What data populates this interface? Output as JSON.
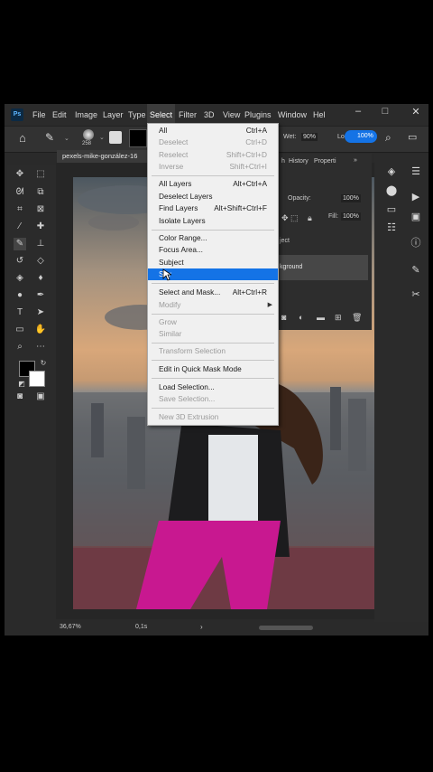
{
  "menubar": {
    "items": [
      "File",
      "Edit",
      "Image",
      "Layer",
      "Type",
      "Select",
      "Filter",
      "3D",
      "View",
      "Plugins",
      "Window",
      "Help"
    ],
    "help_visible": "Hel"
  },
  "window_controls": {
    "minimize": "–",
    "maximize": "□",
    "close": "✕"
  },
  "options_bar": {
    "brush_size": "258",
    "wet_label": "Wet:",
    "wet_value": "90%",
    "load_label": "Lo",
    "flow_value": "100%"
  },
  "document_tab": "pexels-mike-gonzález-16",
  "panels": {
    "tabs": [
      "h",
      "History",
      "Properti"
    ],
    "opacity_label": "Opacity:",
    "opacity_value": "100%",
    "fill_label": "Fill:",
    "fill_value": "100%",
    "subject_text": "ject",
    "layer_name": "kground"
  },
  "status": {
    "zoom": "36,67%",
    "time": "0,1s"
  },
  "select_menu": {
    "items": [
      {
        "label": "All",
        "shortcut": "Ctrl+A",
        "disabled": false
      },
      {
        "label": "Deselect",
        "shortcut": "Ctrl+D",
        "disabled": true
      },
      {
        "label": "Reselect",
        "shortcut": "Shift+Ctrl+D",
        "disabled": true
      },
      {
        "label": "Inverse",
        "shortcut": "Shift+Ctrl+I",
        "disabled": true
      },
      {
        "label": "All Layers",
        "shortcut": "Alt+Ctrl+A",
        "disabled": false
      },
      {
        "label": "Deselect Layers",
        "shortcut": "",
        "disabled": false
      },
      {
        "label": "Find Layers",
        "shortcut": "Alt+Shift+Ctrl+F",
        "disabled": false
      },
      {
        "label": "Isolate Layers",
        "shortcut": "",
        "disabled": false
      },
      {
        "label": "Color Range...",
        "shortcut": "",
        "disabled": false
      },
      {
        "label": "Focus Area...",
        "shortcut": "",
        "disabled": false
      },
      {
        "label": "Subject",
        "shortcut": "",
        "disabled": false
      },
      {
        "label": "Sky",
        "shortcut": "",
        "disabled": false
      },
      {
        "label": "Select and Mask...",
        "shortcut": "Alt+Ctrl+R",
        "disabled": false
      },
      {
        "label": "Modify",
        "shortcut": "",
        "disabled": true
      },
      {
        "label": "Grow",
        "shortcut": "",
        "disabled": true
      },
      {
        "label": "Similar",
        "shortcut": "",
        "disabled": true
      },
      {
        "label": "Transform Selection",
        "shortcut": "",
        "disabled": true
      },
      {
        "label": "Edit in Quick Mask Mode",
        "shortcut": "",
        "disabled": false
      },
      {
        "label": "Load Selection...",
        "shortcut": "",
        "disabled": false
      },
      {
        "label": "Save Selection...",
        "shortcut": "",
        "disabled": true
      },
      {
        "label": "New 3D Extrusion",
        "shortcut": "",
        "disabled": true
      }
    ],
    "highlighted": "Sky"
  },
  "colors": {
    "accent": "#1473e6",
    "panel": "#2b2b2b",
    "menu_bg": "#f0f0f0"
  }
}
